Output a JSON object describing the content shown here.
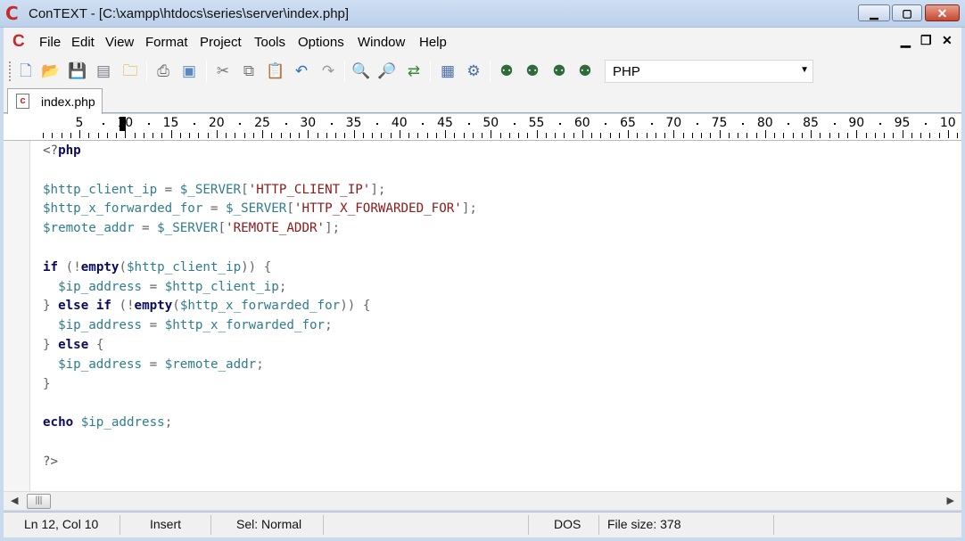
{
  "window": {
    "title": "ConTEXT - [C:\\xampp\\htdocs\\series\\server\\index.php]",
    "logo_icon": "context-logo-icon",
    "controls": {
      "minimize": "minimize-icon",
      "maximize": "maximize-icon",
      "close": "close-icon"
    }
  },
  "menu": {
    "items": [
      "File",
      "Edit",
      "View",
      "Format",
      "Project",
      "Tools",
      "Options",
      "Window",
      "Help"
    ]
  },
  "toolbar": {
    "icons": [
      "new-file-icon",
      "open-file-icon",
      "save-icon",
      "save-all-icon",
      "open-folder-icon",
      "print-icon",
      "print-preview-icon",
      "cut-icon",
      "copy-icon",
      "paste-icon",
      "undo-icon",
      "redo-icon",
      "find-icon",
      "find-next-icon",
      "replace-icon",
      "convert-icon",
      "settings-icon",
      "user-exec-1-icon",
      "user-exec-2-icon",
      "user-exec-3-icon",
      "user-exec-4-icon"
    ],
    "language": "PHP"
  },
  "tabs": [
    {
      "label": "index.php",
      "active": true
    }
  ],
  "ruler": {
    "labels": [
      "5",
      "10",
      "15",
      "20",
      "25",
      "30",
      "35",
      "40",
      "45",
      "50",
      "55",
      "60",
      "65",
      "70",
      "75",
      "80",
      "85",
      "90",
      "95",
      "10"
    ]
  },
  "code": {
    "lines": [
      "<?php",
      "",
      "$http_client_ip = $_SERVER['HTTP_CLIENT_IP'];",
      "$http_x_forwarded_for = $_SERVER['HTTP_X_FORWARDED_FOR'];",
      "$remote_addr = $_SERVER['REMOTE_ADDR'];",
      "",
      "if (!empty($http_client_ip)) {",
      "  $ip_address = $http_client_ip;",
      "} else if (!empty($http_x_forwarded_for)) {",
      "  $ip_address = $http_x_forwarded_for;",
      "} else {",
      "  $ip_address = $remote_addr;",
      "}",
      "",
      "echo $ip_address;",
      "",
      "?>"
    ]
  },
  "status": {
    "position": "Ln 12, Col 10",
    "mode": "Insert",
    "selection": "Sel: Normal",
    "line_ending": "DOS",
    "file_size": "File size: 378"
  },
  "colors": {
    "keyword": "#0a0a5e",
    "variable": "#2e7d8c",
    "string": "#8b1a1a",
    "brand": "#c8282a"
  }
}
